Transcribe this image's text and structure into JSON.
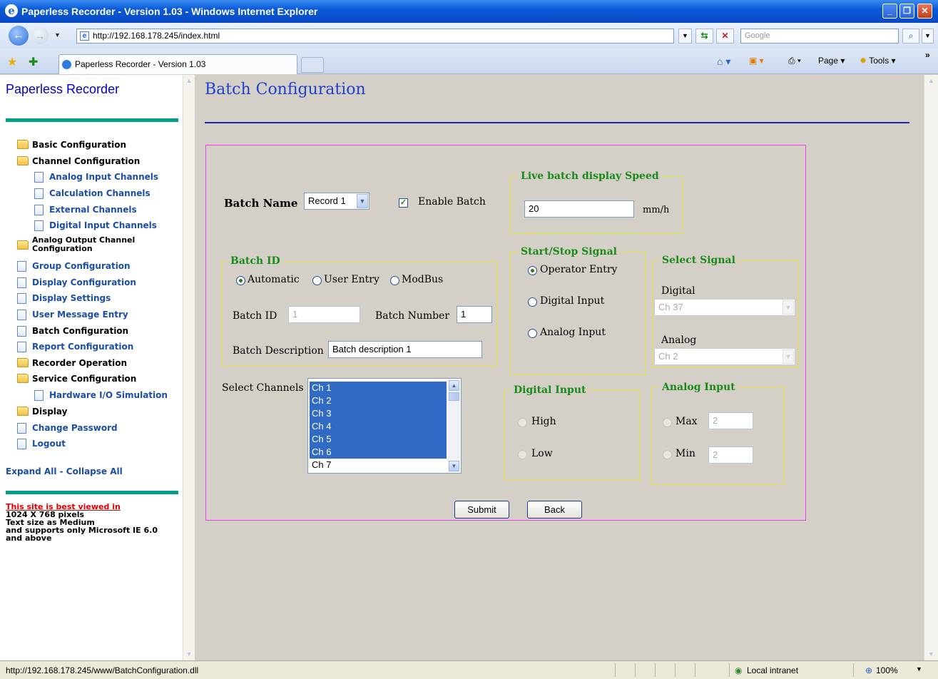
{
  "window": {
    "title": "Paperless Recorder - Version 1.03 - Windows Internet Explorer"
  },
  "browser": {
    "url": "http://192.168.178.245/index.html",
    "search_placeholder": "Google",
    "tab_title": "Paperless Recorder - Version 1.03",
    "page_menu": "Page",
    "tools_menu": "Tools"
  },
  "sidebar": {
    "app_name": "Paperless Recorder",
    "items": [
      {
        "label": "Basic Configuration",
        "icon": "folder-icon"
      },
      {
        "label": "Channel Configuration",
        "icon": "open-folder-icon"
      },
      {
        "label": "Analog Input Channels",
        "icon": "page-icon"
      },
      {
        "label": "Calculation Channels",
        "icon": "page-icon"
      },
      {
        "label": "External Channels",
        "icon": "page-icon"
      },
      {
        "label": "Digital Input Channels",
        "icon": "page-icon"
      },
      {
        "label": "Analog Output Channel",
        "label2": "Configuration",
        "icon": "folder-icon"
      },
      {
        "label": "Group Configuration",
        "icon": "page-icon"
      },
      {
        "label": "Display Configuration",
        "icon": "page-icon"
      },
      {
        "label": "Display Settings",
        "icon": "page-icon"
      },
      {
        "label": "User Message Entry",
        "icon": "page-icon"
      },
      {
        "label": "Batch Configuration",
        "icon": "page-icon"
      },
      {
        "label": "Report Configuration",
        "icon": "page-icon"
      },
      {
        "label": "Recorder Operation",
        "icon": "folder-icon"
      },
      {
        "label": "Service Configuration",
        "icon": "open-folder-icon"
      },
      {
        "label": "Hardware I/O Simulation",
        "icon": "page-icon"
      },
      {
        "label": "Display",
        "icon": "folder-icon"
      },
      {
        "label": "Change Password",
        "icon": "page-icon"
      },
      {
        "label": "Logout",
        "icon": "page-icon"
      }
    ],
    "expand_collapse": "Expand All - Collapse All",
    "note_lines": [
      "This site is best viewed in",
      "1024 X 768 pixels",
      "Text size as Medium",
      "and supports only Microsoft IE 6.0",
      "and above"
    ]
  },
  "main": {
    "title": "Batch Configuration",
    "batch_name_label": "Batch Name",
    "batch_name_value": "Record 1",
    "enable_batch_label": "Enable Batch",
    "enable_batch_checked": true,
    "live_speed": {
      "legend": "Live batch display Speed",
      "value": "20",
      "unit": "mm/h"
    },
    "batch_id": {
      "legend": "Batch ID",
      "options": [
        "Automatic",
        "User Entry",
        "ModBus"
      ],
      "selected": "Automatic",
      "id_label": "Batch ID",
      "id_value": "1",
      "number_label": "Batch Number",
      "number_value": "1",
      "desc_label": "Batch Description",
      "desc_value": "Batch description 1"
    },
    "start_stop": {
      "legend": "Start/Stop Signal",
      "options": [
        "Operator Entry",
        "Digital Input",
        "Analog Input"
      ],
      "selected": "Operator Entry"
    },
    "select_signal": {
      "legend": "Select Signal",
      "digital_label": "Digital",
      "digital_value": "Ch 37",
      "analog_label": "Analog",
      "analog_value": "Ch 2"
    },
    "select_channels_label": "Select Channels",
    "channels": [
      "Ch 1",
      "Ch 2",
      "Ch 3",
      "Ch 4",
      "Ch 5",
      "Ch 6",
      "Ch 7"
    ],
    "selected_channels": [
      "Ch 1",
      "Ch 2",
      "Ch 3",
      "Ch 4",
      "Ch 5",
      "Ch 6"
    ],
    "digital_input": {
      "legend": "Digital Input",
      "high": "High",
      "low": "Low"
    },
    "analog_input": {
      "legend": "Analog Input",
      "max_label": "Max",
      "max_value": "2",
      "min_label": "Min",
      "min_value": "2"
    },
    "submit_label": "Submit",
    "back_label": "Back"
  },
  "status": {
    "url": "http://192.168.178.245/www/BatchConfiguration.dll",
    "zone": "Local intranet",
    "zoom": "100%"
  }
}
